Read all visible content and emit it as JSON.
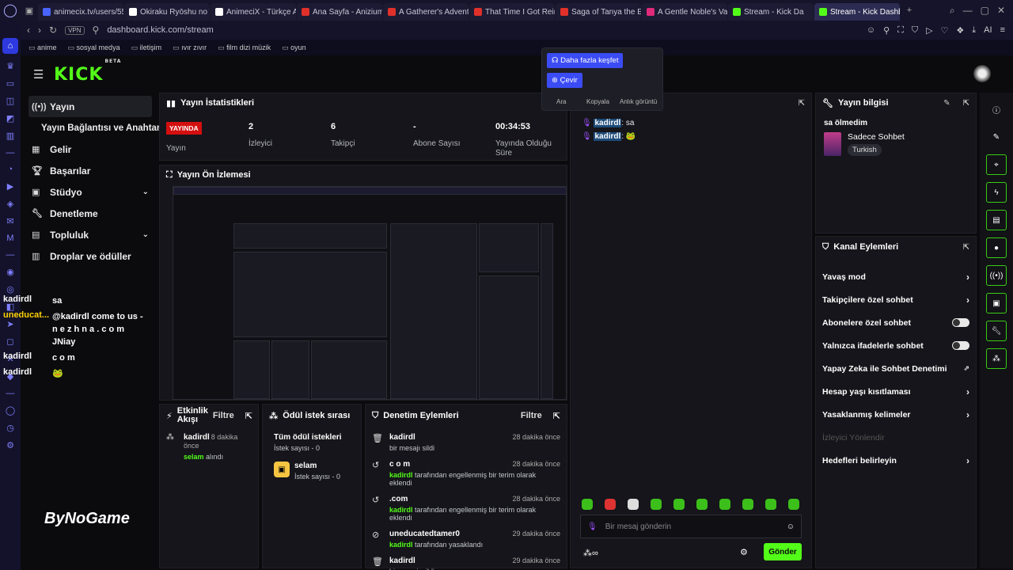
{
  "browser": {
    "tabs": [
      {
        "label": "animecix.tv/users/55",
        "active": false,
        "kick": false,
        "color": "#4a63ff"
      },
      {
        "label": "Okiraku Ryōshu no T",
        "active": false,
        "kick": false,
        "color": "#ffffff"
      },
      {
        "label": "AnimeciX - Türkçe Ar",
        "active": false,
        "kick": false,
        "color": "#ffffff"
      },
      {
        "label": "Ana Sayfa - Anizium",
        "active": false,
        "kick": false,
        "color": "#e0302a"
      },
      {
        "label": "A Gatherer's Adventu",
        "active": false,
        "kick": false,
        "color": "#e0302a"
      },
      {
        "label": "That Time I Got Reinc",
        "active": false,
        "kick": false,
        "color": "#e0302a"
      },
      {
        "label": "Saga of Tanya the E",
        "active": false,
        "kick": false,
        "color": "#e0302a"
      },
      {
        "label": "A Gentle Noble's Vac",
        "active": false,
        "kick": false,
        "color": "#e02a7a"
      },
      {
        "label": "Stream - Kick Da",
        "active": false,
        "kick": true,
        "color": "#53fc18"
      },
      {
        "label": "Stream - Kick Dashbo",
        "active": true,
        "kick": true,
        "color": "#53fc18"
      }
    ],
    "url": "dashboard.kick.com/stream",
    "vpn": "VPN",
    "bookmarks": [
      "anime",
      "sosyal medya",
      "iletişim",
      "ıvır zıvır",
      "film dizi müzik",
      "oyun"
    ]
  },
  "brand": {
    "logo": "KICK",
    "tag": "BETA",
    "accent": "#53fc18"
  },
  "nav": {
    "yayin": "Yayın",
    "yayin_baglanti": "Yayın Bağlantısı ve Anahtarı",
    "gelir": "Gelir",
    "basarilar": "Başarılar",
    "studyo": "Stüdyo",
    "denetleme": "Denetleme",
    "topluluk": "Topluluk",
    "droplar": "Droplar ve ödüller"
  },
  "overlay": {
    "rows": [
      {
        "user": "kadirdl",
        "msg": "sa"
      },
      {
        "user": "uneducat...",
        "msg": "@kadirdl come to us - n e z h n a . c o m JNiay"
      },
      {
        "user": "kadirdl",
        "msg": "c o m"
      },
      {
        "user": "kadirdl",
        "msg": "🐸"
      }
    ],
    "sponsor": "ByNoGame"
  },
  "stats": {
    "title": "Yayın İstatistikleri",
    "live_badge": "YAYINDA",
    "status_label": "Yayın",
    "viewers": "2",
    "viewers_label": "İzleyici",
    "followers": "6",
    "followers_label": "Takipçi",
    "subs": "-",
    "subs_label": "Abone Sayısı",
    "duration": "00:34:53",
    "duration_label": "Yayında Olduğu Süre"
  },
  "preview": {
    "title": "Yayın Ön İzlemesi"
  },
  "activity": {
    "title": "Etkinlik Akışı",
    "filter": "Filtre",
    "items": [
      {
        "user": "kadirdl",
        "time": "8 dakika önce",
        "reward": "selam",
        "action": "alındı"
      }
    ]
  },
  "rewards": {
    "title": "Ödül istek sırası",
    "all_label": "Tüm ödül istekleri",
    "all_count": "İstek sayısı - 0",
    "item_name": "selam",
    "item_count": "İstek sayısı - 0"
  },
  "moderation": {
    "title": "Denetim Eylemleri",
    "filter": "Filtre",
    "items": [
      {
        "icon": "trash-icon",
        "user": "kadirdl",
        "time": "28 dakika önce",
        "actor": "",
        "desc": "bir mesajı sildi"
      },
      {
        "icon": "undo-icon",
        "user": "c o m",
        "time": "28 dakika önce",
        "actor": "kadirdl",
        "desc": "tarafından engellenmiş bir terim olarak eklendi"
      },
      {
        "icon": "undo-icon",
        "user": ".com",
        "time": "28 dakika önce",
        "actor": "kadirdl",
        "desc": "tarafından engellenmiş bir terim olarak eklendi"
      },
      {
        "icon": "ban-icon",
        "user": "uneducatedtamer0",
        "time": "29 dakika önce",
        "actor": "kadirdl",
        "desc": "tarafından yasaklandı"
      },
      {
        "icon": "trash-icon",
        "user": "kadirdl",
        "time": "29 dakika önce",
        "actor": "",
        "desc": "bir mesajı sildi"
      }
    ]
  },
  "chat": {
    "lines": [
      {
        "user": "kadirdl",
        "msg": ": sa"
      },
      {
        "user": "kadirdl",
        "msg": ":"
      }
    ],
    "placeholder": "Bir mesaj gönderin",
    "send": "Gönder",
    "menu": {
      "discover": "Daha fazla keşfet",
      "translate": "Çevir",
      "search": "Ara",
      "copy": "Kopyala",
      "snapshot": "Anlık görüntü"
    }
  },
  "stream_info": {
    "title": "Yayın bilgisi",
    "stream_title": "sa ölmedim",
    "category": "Sadece Sohbet",
    "language": "Turkish"
  },
  "channel_actions": {
    "title": "Kanal Eylemleri",
    "slow_mode": "Yavaş mod",
    "followers_only": "Takipçilere özel sohbet",
    "subs_only": "Abonelere özel sohbet",
    "emotes_only": "Yalnızca ifadelerle sohbet",
    "ai_moderation": "Yapay Zeka ile Sohbet Denetimi",
    "age_restriction": "Hesap yaşı kısıtlaması",
    "banned_words": "Yasaklanmış kelimeler",
    "redirect": "İzleyici Yönlendir",
    "goals": "Hedefleri belirleyin"
  }
}
